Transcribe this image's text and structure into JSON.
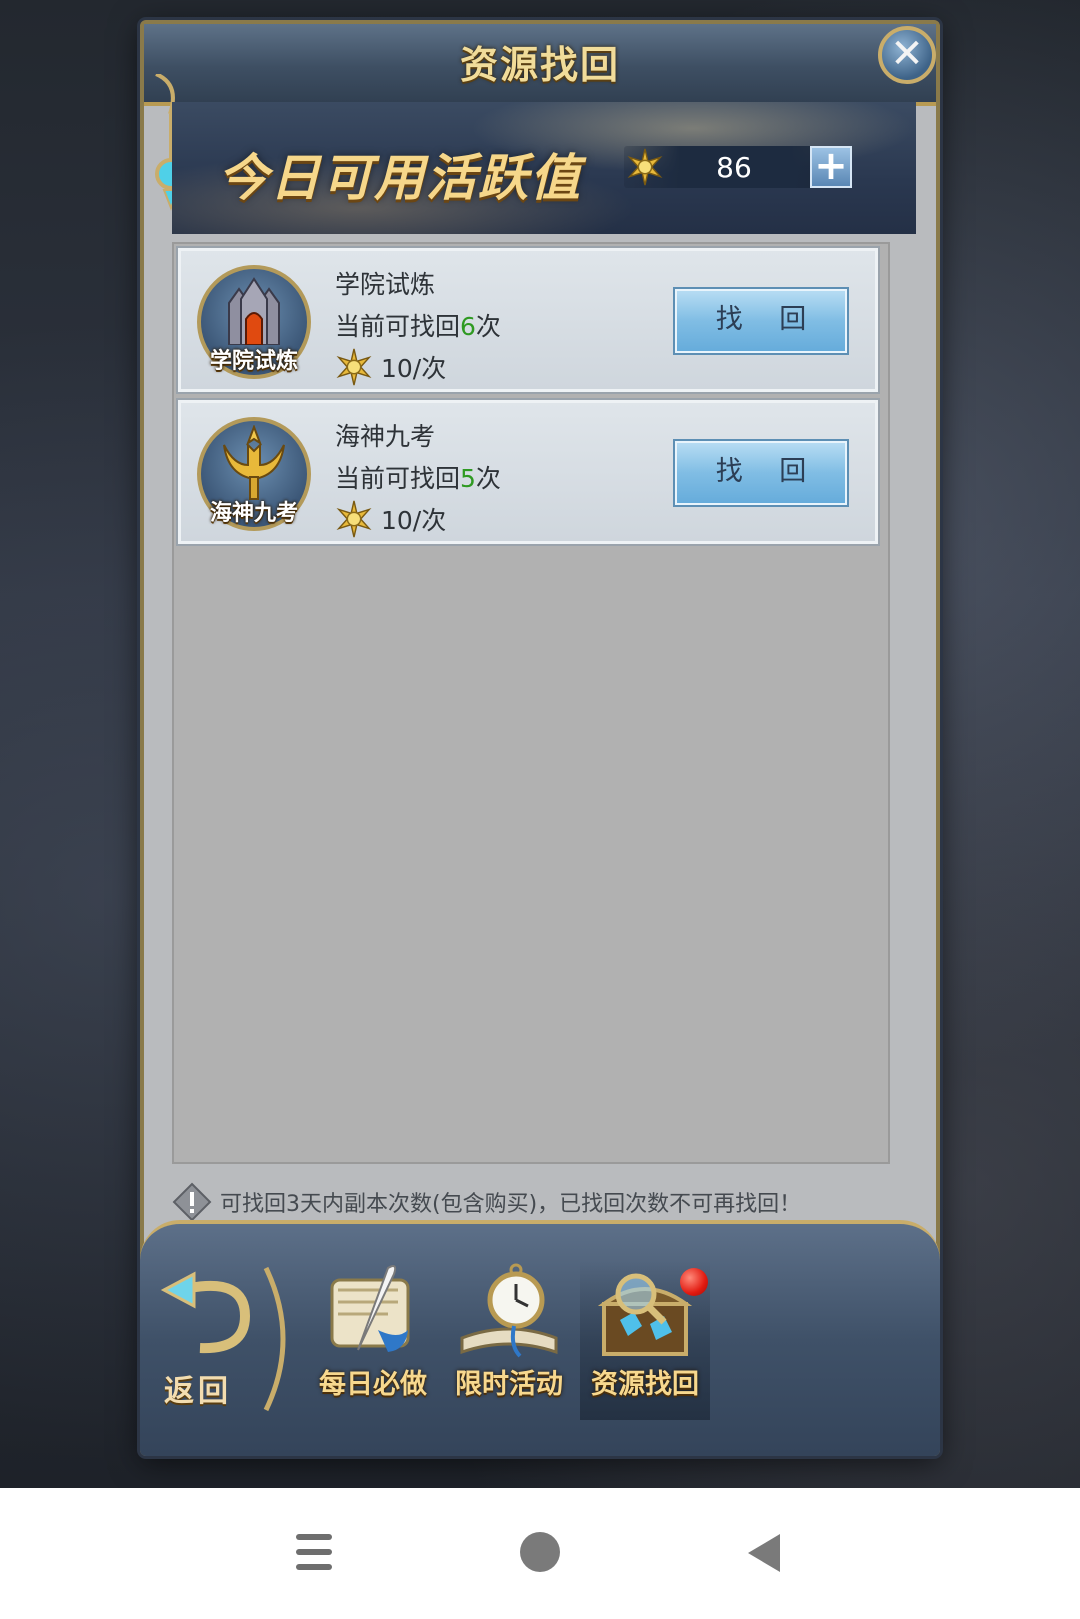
{
  "dialog": {
    "title": "资源找回",
    "close_icon": "close-icon"
  },
  "activity": {
    "label": "今日可用活跃值",
    "value": "86",
    "plus": "+",
    "icon": "sun-star-icon"
  },
  "items": [
    {
      "icon_label": "学院试炼",
      "name": "学院试炼",
      "count_prefix": "当前可找回",
      "count": "6",
      "count_suffix": "次",
      "cost": "10/次",
      "button": "找 回"
    },
    {
      "icon_label": "海神九考",
      "name": "海神九考",
      "count_prefix": "当前可找回",
      "count": "5",
      "count_suffix": "次",
      "cost": "10/次",
      "button": "找 回"
    }
  ],
  "notice": "可找回3天内副本次数(包含购买)，已找回次数不可再找回！",
  "bottom_nav": {
    "back": "返回",
    "tabs": [
      {
        "label": "每日必做",
        "icon": "scroll-quill-icon"
      },
      {
        "label": "限时活动",
        "icon": "pocket-watch-book-icon"
      },
      {
        "label": "资源找回",
        "icon": "treasure-chest-magnifier-icon",
        "selected": true,
        "badge": true
      }
    ]
  },
  "colors": {
    "accent_gold": "#f1dc9a",
    "count_green": "#2f9a22",
    "button_blue": "#80bde4",
    "badge_red": "#e11a10"
  }
}
